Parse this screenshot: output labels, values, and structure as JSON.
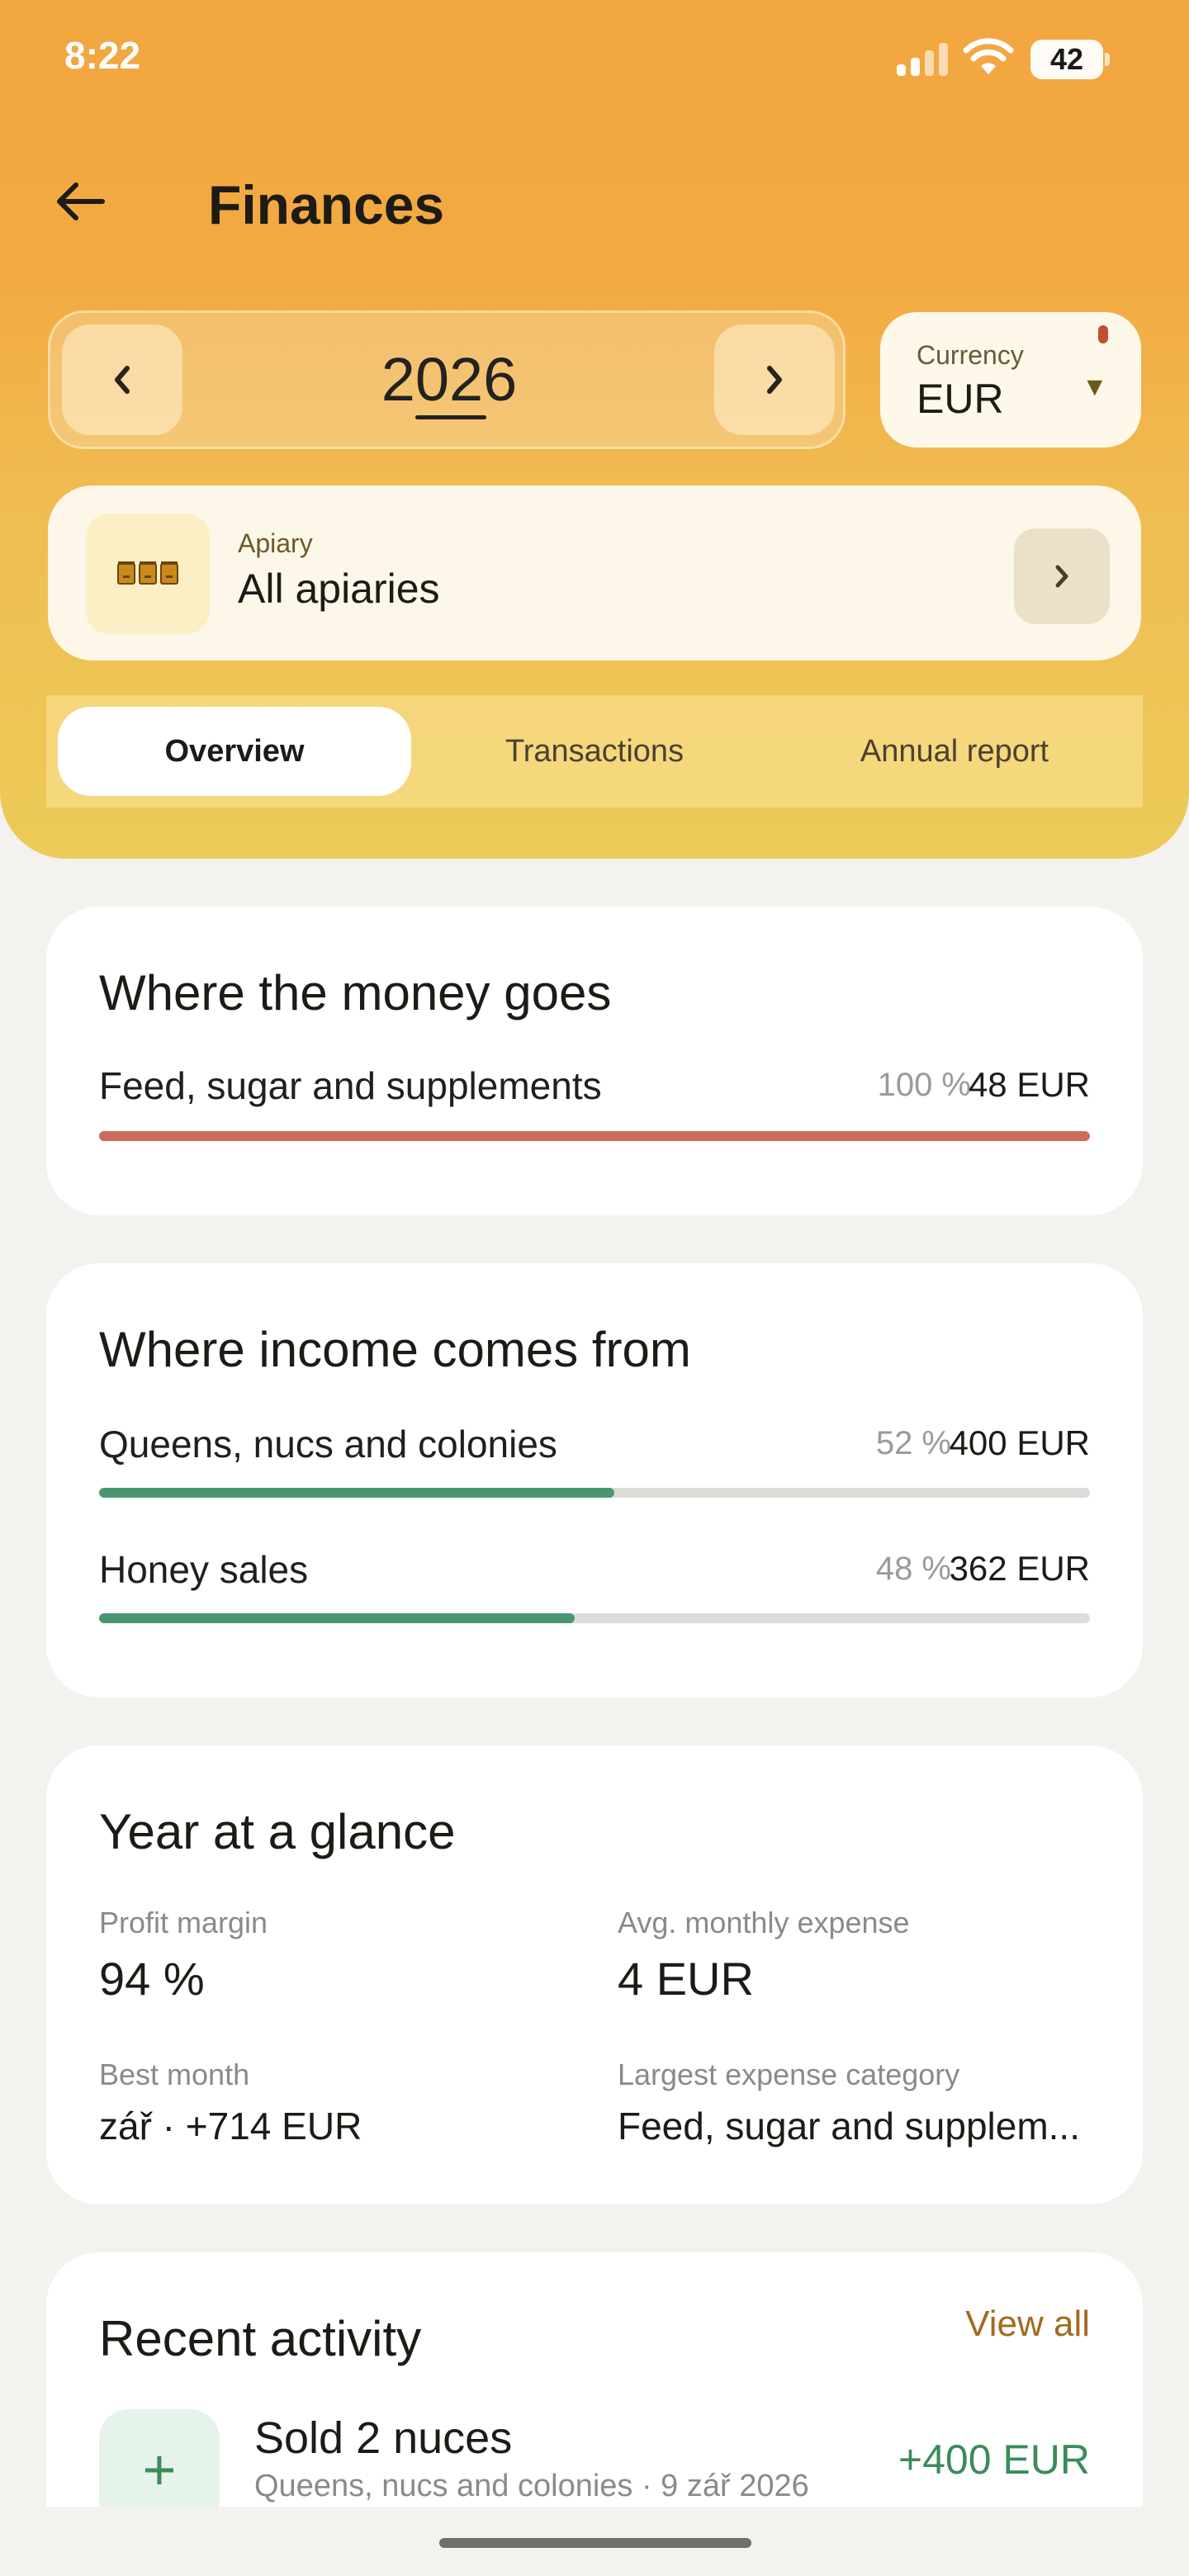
{
  "status_bar": {
    "time": "8:22",
    "battery": "42"
  },
  "header": {
    "title": "Finances"
  },
  "year_selector": {
    "year": "2026"
  },
  "currency": {
    "label": "Currency",
    "value": "EUR"
  },
  "apiary": {
    "label": "Apiary",
    "value": "All apiaries",
    "icon": "beehives-icon"
  },
  "tabs": [
    {
      "label": "Overview",
      "active": true
    },
    {
      "label": "Transactions",
      "active": false
    },
    {
      "label": "Annual report",
      "active": false
    }
  ],
  "expenses": {
    "title": "Where the money goes",
    "rows": [
      {
        "label": "Feed, sugar and supplements",
        "percent": "100 %",
        "amount": "48 EUR",
        "fraction": 1.0
      }
    ],
    "color": "#cc6b5a"
  },
  "income": {
    "title": "Where income comes from",
    "rows": [
      {
        "label": "Queens, nucs and colonies",
        "percent": "52 %",
        "amount": "400 EUR",
        "fraction": 0.52
      },
      {
        "label": "Honey sales",
        "percent": "48 %",
        "amount": "362 EUR",
        "fraction": 0.48
      }
    ],
    "color": "#4a9670"
  },
  "glance": {
    "title": "Year at a glance",
    "profit_margin_label": "Profit margin",
    "profit_margin_value": "94 %",
    "avg_expense_label": "Avg. monthly expense",
    "avg_expense_value": "4 EUR",
    "best_month_label": "Best month",
    "best_month_value": "zář · +714 EUR",
    "largest_category_label": "Largest expense category",
    "largest_category_value": "Feed, sugar and supplem..."
  },
  "recent": {
    "title": "Recent activity",
    "view_all": "View all",
    "items": [
      {
        "title": "Sold 2 nuces",
        "subtitle": "Queens, nucs and colonies · 9 zář 2026",
        "amount": "+400 EUR",
        "icon_glyph": "+"
      }
    ]
  },
  "colors": {
    "accent": "#f2a640",
    "income": "#4a9670",
    "expense": "#cc6b5a"
  }
}
